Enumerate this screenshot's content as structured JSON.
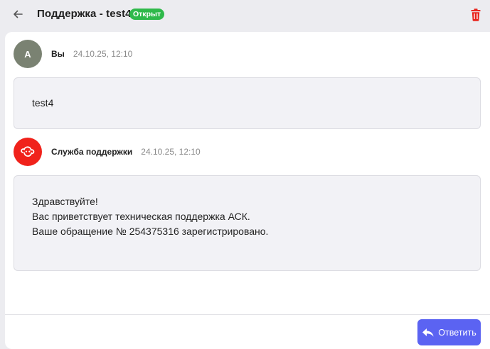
{
  "header": {
    "title": "Поддержка - test4",
    "status": "Открыт",
    "status_color": "#2fb94a"
  },
  "messages": [
    {
      "avatar_letter": "А",
      "author": "Вы",
      "time": "24.10.25, 12:10",
      "text": [
        "test4"
      ]
    },
    {
      "avatar_icon": "support-logo-icon",
      "author": "Служба поддержки",
      "time": "24.10.25, 12:10",
      "text": [
        "Здравствуйте!",
        "Вас приветствует техническая поддержка АСК.",
        "Ваше обращение № 254375316 зарегистрировано."
      ]
    }
  ],
  "footer": {
    "reply_label": "Ответить",
    "accent": "#5b63f2"
  },
  "colors": {
    "delete": "#e8231c",
    "support_avatar": "#f0221b"
  }
}
